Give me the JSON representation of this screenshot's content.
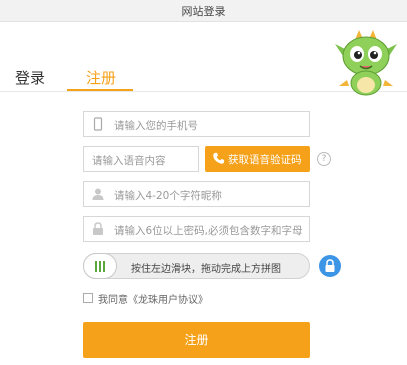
{
  "window": {
    "title": "网站登录"
  },
  "tabs": {
    "login": "登录",
    "register": "注册"
  },
  "form": {
    "phone_placeholder": "请输入您的手机号",
    "voice_code_placeholder": "请输入语音内容",
    "voice_button": "获取语音验证码",
    "help_symbol": "?",
    "nickname_placeholder": "请输入4-20个字符昵称",
    "password_placeholder": "请输入6位以上密码,必须包含数字和字母",
    "slider_text": "按住左边滑块，拖动完成上方拼图",
    "agreement_text": "我同意《龙珠用户协议》",
    "submit_label": "注册"
  },
  "colors": {
    "accent": "#f5a11a",
    "slider_grip": "#5aa838",
    "lock_blue": "#3d95e6"
  },
  "icons": [
    "phone-outline-icon",
    "phone-icon",
    "question-icon",
    "user-icon",
    "lock-icon",
    "slider-grip-icon",
    "lock-badge-icon",
    "dragon-mascot-icon"
  ]
}
